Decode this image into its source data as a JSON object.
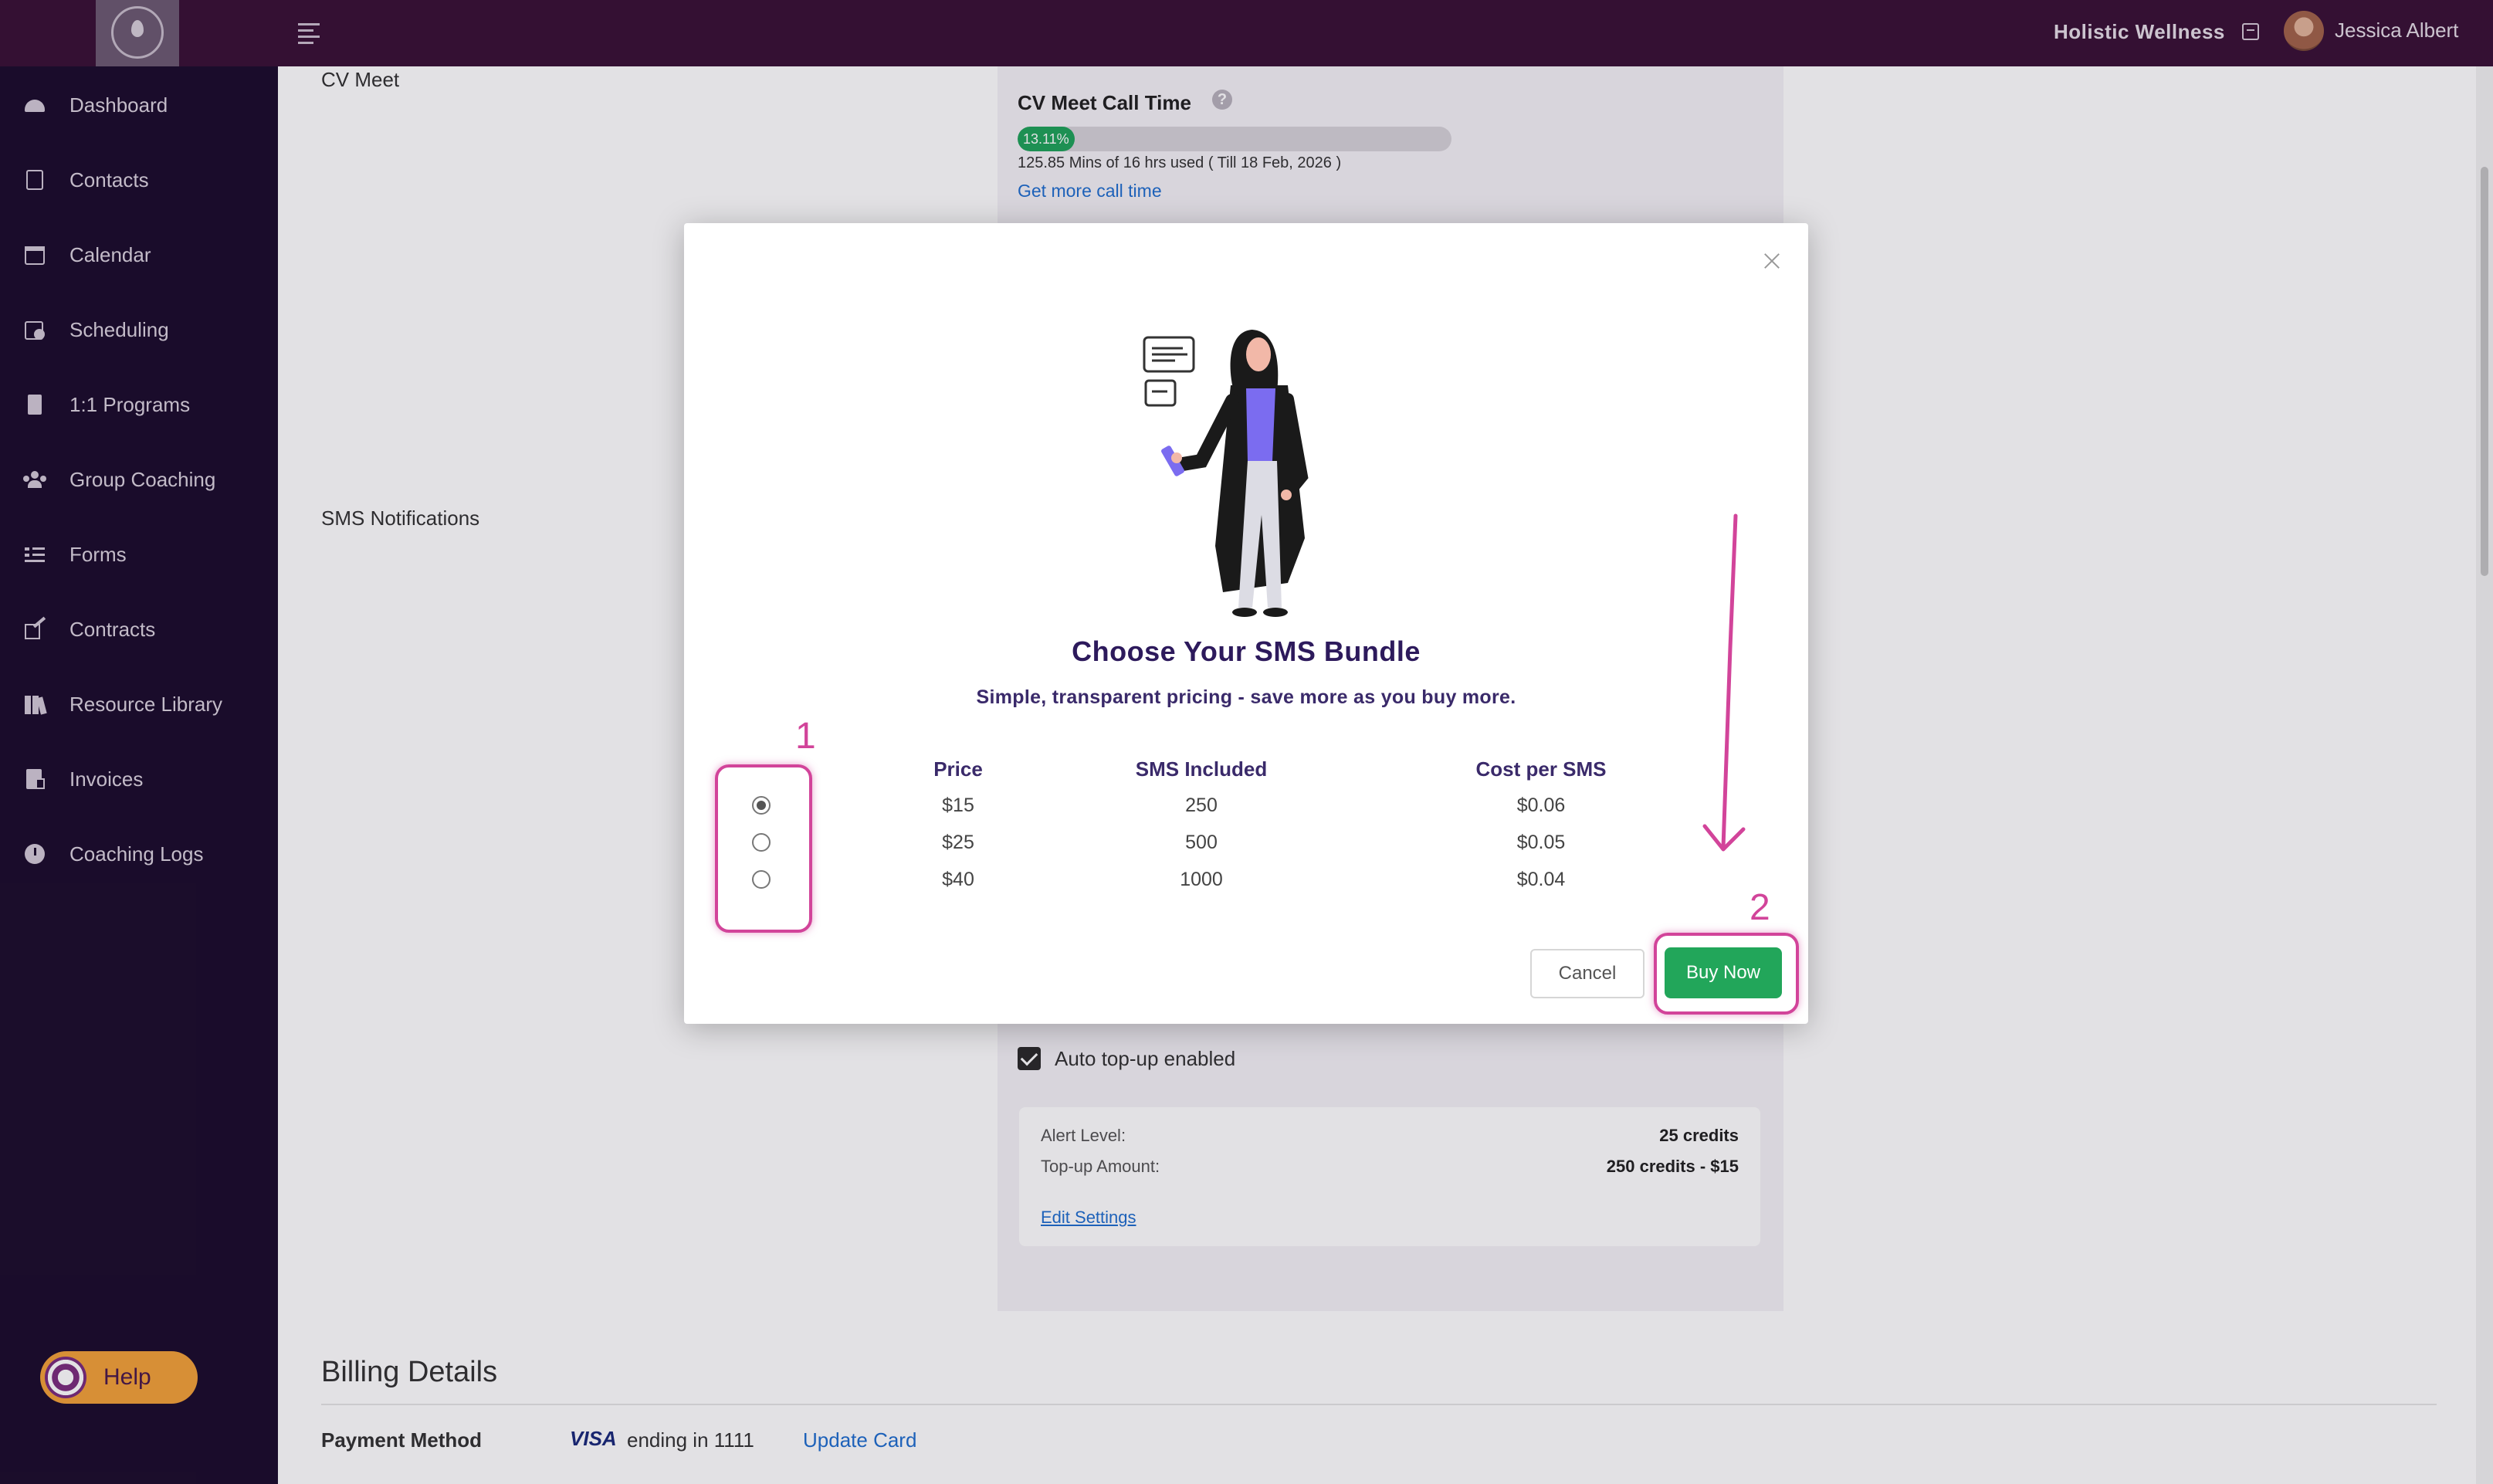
{
  "header": {
    "brand_name": "Holistic Wellness",
    "user_name": "Jessica Albert"
  },
  "sidebar": {
    "items": [
      {
        "label": "Dashboard",
        "icon": "dashboard-icon"
      },
      {
        "label": "Contacts",
        "icon": "contacts-icon"
      },
      {
        "label": "Calendar",
        "icon": "calendar-icon"
      },
      {
        "label": "Scheduling",
        "icon": "scheduling-icon"
      },
      {
        "label": "1:1 Programs",
        "icon": "book-icon"
      },
      {
        "label": "Group Coaching",
        "icon": "group-icon"
      },
      {
        "label": "Forms",
        "icon": "forms-icon"
      },
      {
        "label": "Contracts",
        "icon": "contracts-icon"
      },
      {
        "label": "Resource Library",
        "icon": "library-icon"
      },
      {
        "label": "Invoices",
        "icon": "invoice-icon"
      },
      {
        "label": "Coaching Logs",
        "icon": "clock-icon"
      }
    ],
    "help_label": "Help"
  },
  "main": {
    "cv_meet_label": "CV Meet",
    "call_time_title": "CV Meet Call Time",
    "progress_percent": 13.11,
    "progress_label": "13.11%",
    "usage_text": "125.85 Mins of 16 hrs used ( Till 18 Feb, 2026 )",
    "get_more_link": "Get more call time",
    "sms_label": "SMS Notifications",
    "auto_topup_label": "Auto top-up enabled",
    "auto_topup_checked": true,
    "alert_level_label": "Alert Level:",
    "alert_level_value": "25 credits",
    "topup_amount_label": "Top-up Amount:",
    "topup_amount_value": "250 credits - $15",
    "edit_settings_link": "Edit Settings",
    "billing_title": "Billing Details",
    "payment_method_label": "Payment Method",
    "card_brand": "VISA",
    "card_ending": "ending in 1111",
    "update_card_link": "Update Card"
  },
  "modal": {
    "title": "Choose Your SMS Bundle",
    "subtitle": "Simple, transparent pricing - save more as you buy more.",
    "columns": [
      "Price",
      "SMS Included",
      "Cost per SMS"
    ],
    "rows": [
      {
        "price": "$15",
        "sms": "250",
        "cost": "$0.06",
        "selected": true
      },
      {
        "price": "$25",
        "sms": "500",
        "cost": "$0.05",
        "selected": false
      },
      {
        "price": "$40",
        "sms": "1000",
        "cost": "$0.04",
        "selected": false
      }
    ],
    "cancel_label": "Cancel",
    "buy_label": "Buy Now"
  },
  "annotations": {
    "step1": "1",
    "step2": "2",
    "color": "#d2449a"
  },
  "colors": {
    "topbar": "#3a1236",
    "sidebar": "#1c0d2d",
    "accent_green": "#22a65a",
    "title_purple": "#2d1a5c"
  }
}
